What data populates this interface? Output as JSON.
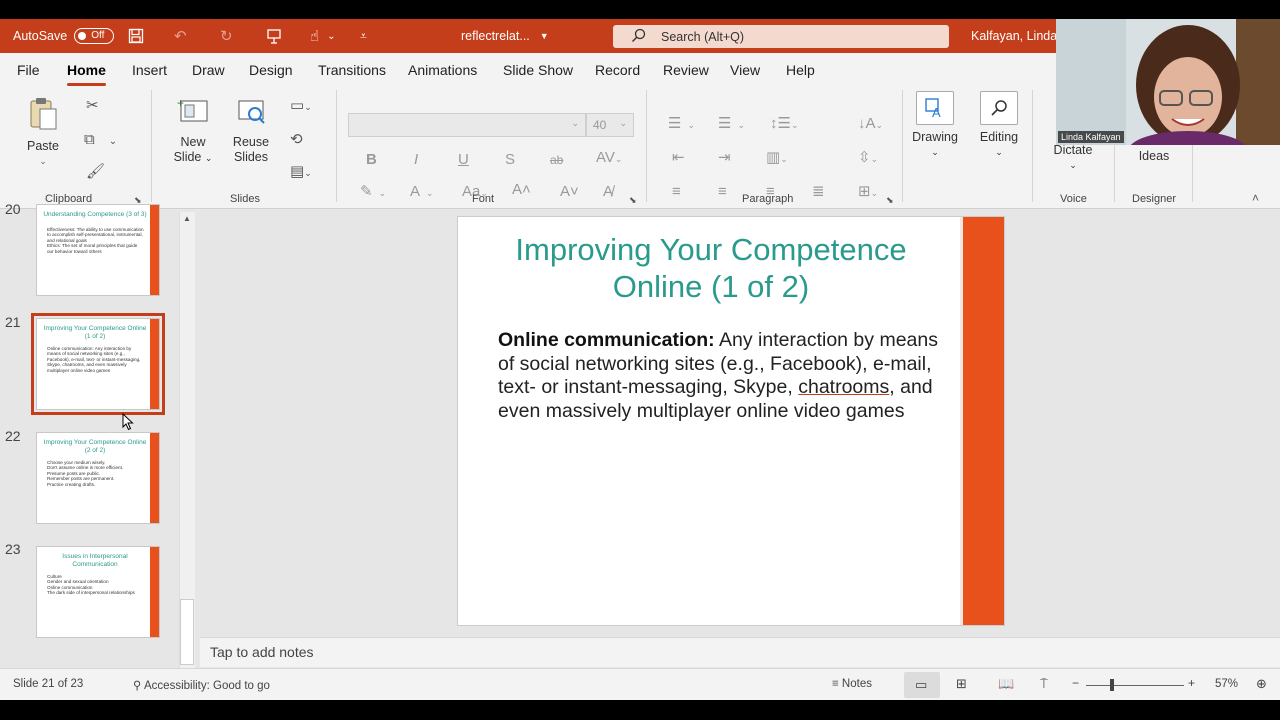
{
  "titlebar": {
    "autosave_label": "AutoSave",
    "autosave_state": "Off",
    "filename": "reflectrelat...",
    "search_placeholder": "Search (Alt+Q)",
    "user_name": "Kalfayan, Linda"
  },
  "menu": {
    "tabs": [
      "File",
      "Home",
      "Insert",
      "Draw",
      "Design",
      "Transitions",
      "Animations",
      "Slide Show",
      "Record",
      "Review",
      "View",
      "Help"
    ],
    "active": "Home"
  },
  "ribbon": {
    "clipboard": {
      "paste_label": "Paste",
      "group_label": "Clipboard"
    },
    "slides": {
      "new_slide_label_1": "New",
      "new_slide_label_2": "Slide",
      "reuse_label_1": "Reuse",
      "reuse_label_2": "Slides",
      "group_label": "Slides"
    },
    "font": {
      "size_value": "40",
      "group_label": "Font"
    },
    "paragraph": {
      "group_label": "Paragraph"
    },
    "drawing_label": "Drawing",
    "editing_label": "Editing",
    "voice": {
      "dictate_label": "Dictate",
      "group_label": "Voice"
    },
    "designer": {
      "ideas_label": "Ideas",
      "group_label": "Designer"
    }
  },
  "thumbnails": [
    {
      "num": "20",
      "title": "Understanding Competence (3 of 3)",
      "body": "Effectiveness: The ability to use communication to accomplish self-presentational, instrumental, and relational goals\nEthics: The set of moral principles that guide our behavior toward others"
    },
    {
      "num": "21",
      "title": "Improving Your Competence Online (1 of 2)",
      "body": "Online communication: Any interaction by means of social networking sites (e.g., Facebook), e-mail, text- or instant-messaging, Skype, chatrooms, and even massively multiplayer online video games"
    },
    {
      "num": "22",
      "title": "Improving Your Competence Online (2 of 2)",
      "body": "Choose your medium wisely.\nDon't assume online is more efficient.\nPresume posts are public.\nRemember posts are permanent.\nPractice creating drafts."
    },
    {
      "num": "23",
      "title": "Issues in Interpersonal Communication",
      "body": "Culture\nGender and sexual orientation\nOnline communication\nThe dark side of interpersonal relationships"
    }
  ],
  "slide": {
    "title_line1": "Improving Your Competence",
    "title_line2": "Online (1 of 2)",
    "term": "Online communication:",
    "body_part1": " Any interaction by means of social networking sites (e.g., Facebook), e-mail, text- or instant-messaging, Skype, ",
    "body_underlined": "chatrooms",
    "body_part2": ", and even massively multiplayer online video games"
  },
  "notes_placeholder": "Tap to add notes",
  "status": {
    "slide_info": "Slide 21 of 23",
    "accessibility": "Accessibility: Good to go",
    "notes_label": "Notes",
    "zoom": "57%",
    "zoom_fraction": 0.57
  },
  "webcam": {
    "participant_name": "Linda Kalfayan"
  },
  "colors": {
    "accent": "#c43e1c",
    "slide_bar": "#e8501c",
    "title_teal": "#2a9a8c"
  }
}
